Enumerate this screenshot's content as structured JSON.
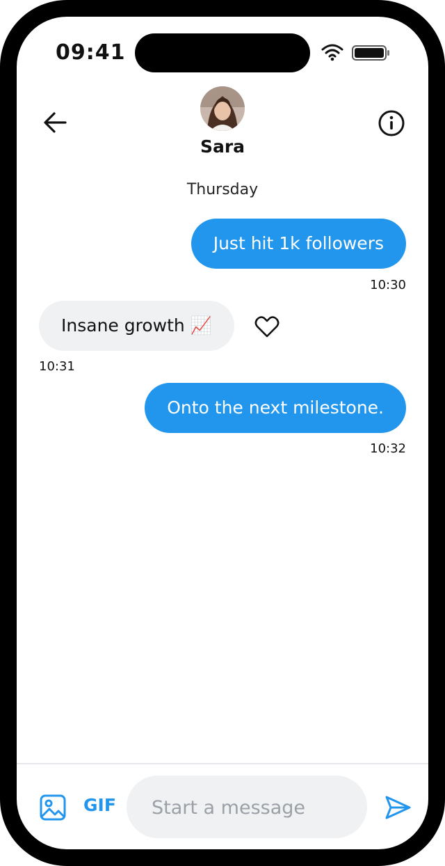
{
  "status_bar": {
    "time": "09:41"
  },
  "header": {
    "contact_name": "Sara"
  },
  "conversation": {
    "day_label": "Thursday",
    "messages": [
      {
        "direction": "outgoing",
        "text": "Just hit 1k followers",
        "time": "10:30"
      },
      {
        "direction": "incoming",
        "text": "Insane growth 📈",
        "time": "10:31",
        "reaction": "heart-outline"
      },
      {
        "direction": "outgoing",
        "text": "Onto the next milestone.",
        "time": "10:32"
      }
    ]
  },
  "composer": {
    "gif_label": "GIF",
    "placeholder": "Start a message",
    "value": ""
  },
  "colors": {
    "accent": "#2196EC",
    "incoming_bubble": "#F0F1F3",
    "text": "#111111"
  },
  "icons": [
    "back-arrow-icon",
    "info-icon",
    "heart-icon",
    "image-icon",
    "send-icon",
    "wifi-icon",
    "battery-icon"
  ]
}
